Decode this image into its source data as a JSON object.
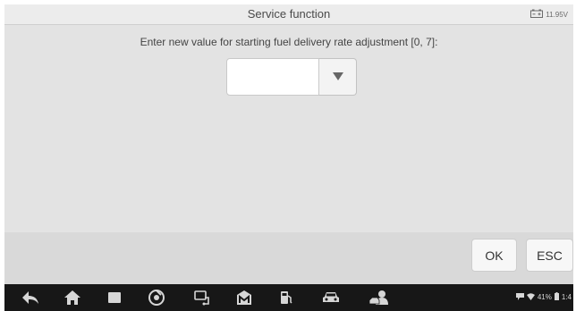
{
  "header": {
    "title": "Service function",
    "battery_voltage": "11.95V"
  },
  "dialog": {
    "prompt": "Enter new value for starting fuel delivery rate adjustment [0, 7]:",
    "input_value": "",
    "dropdown_icon": "triangle-down-icon"
  },
  "buttons": {
    "ok_label": "OK",
    "esc_label": "ESC"
  },
  "navbar": {
    "icons": [
      "back-icon",
      "home-icon",
      "recent-apps-icon",
      "chrome-icon",
      "vci-icon",
      "maxi-logo-icon",
      "fuel-icon",
      "car-icon",
      "technician-icon"
    ]
  },
  "status_bar": {
    "battery_percent": "41%",
    "time": "1:4"
  },
  "colors": {
    "background": "#e4e4e4",
    "navbar": "#171717",
    "nav_icon": "#d6d6d6"
  }
}
